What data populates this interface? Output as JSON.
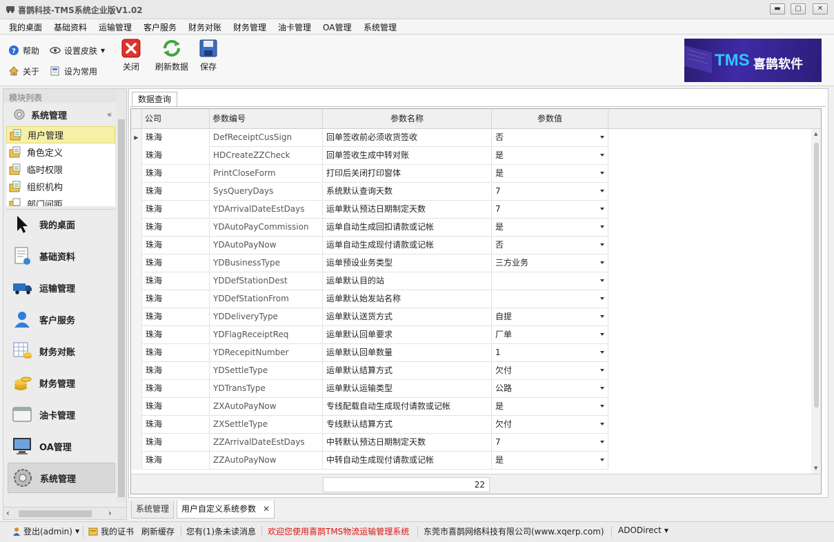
{
  "window": {
    "title": "喜鹊科技-TMS系统企业版V1.02",
    "min_label": "▬",
    "max_label": "□",
    "close_label": "✕"
  },
  "menu": {
    "items": [
      "我的桌面",
      "基础资料",
      "运输管理",
      "客户服务",
      "财务对账",
      "财务管理",
      "油卡管理",
      "OA管理",
      "系统管理"
    ]
  },
  "toolbar": {
    "help": "帮助",
    "skin": "设置皮肤",
    "about": "关于",
    "set_common": "设为常用",
    "close": "关闭",
    "refresh": "刷新数据",
    "save": "保存"
  },
  "logo": {
    "tms": "TMS",
    "brand": "喜鹊软件"
  },
  "left_panel": {
    "header": "模块列表",
    "group": "系统管理",
    "collapse": "«",
    "sub_items": [
      "用户管理",
      "角色定义",
      "临时权限",
      "组织机构",
      "部门间距"
    ],
    "selected_sub": 0,
    "nav": [
      "我的桌面",
      "基础资料",
      "运输管理",
      "客户服务",
      "财务对账",
      "财务管理",
      "油卡管理",
      "OA管理",
      "系统管理"
    ],
    "active_nav": 8,
    "scroll_left": "‹",
    "scroll_right": "›"
  },
  "main": {
    "tab": "数据查询",
    "columns": [
      "公司",
      "参数编号",
      "参数名称",
      "参数值"
    ],
    "rows": [
      {
        "company": "珠海",
        "code": "DefReceiptCusSign",
        "name": "回单签收前必须收货签收",
        "value": "否"
      },
      {
        "company": "珠海",
        "code": "HDCreateZZCheck",
        "name": "回单签收生成中转对账",
        "value": "是"
      },
      {
        "company": "珠海",
        "code": "PrintCloseForm",
        "name": "打印后关闭打印窗体",
        "value": "是"
      },
      {
        "company": "珠海",
        "code": "SysQueryDays",
        "name": "系统默认查询天数",
        "value": "7"
      },
      {
        "company": "珠海",
        "code": "YDArrivalDateEstDays",
        "name": "运单默认预达日期制定天数",
        "value": "7"
      },
      {
        "company": "珠海",
        "code": "YDAutoPayCommission",
        "name": "运单自动生成回扣请款或记帐",
        "value": "是"
      },
      {
        "company": "珠海",
        "code": "YDAutoPayNow",
        "name": "运单自动生成现付请款或记帐",
        "value": "否"
      },
      {
        "company": "珠海",
        "code": "YDBusinessType",
        "name": "运单预设业务类型",
        "value": "三方业务"
      },
      {
        "company": "珠海",
        "code": "YDDefStationDest",
        "name": "运单默认目的站",
        "value": ""
      },
      {
        "company": "珠海",
        "code": "YDDefStationFrom",
        "name": "运单默认始发站名称",
        "value": ""
      },
      {
        "company": "珠海",
        "code": "YDDeliveryType",
        "name": "运单默认送货方式",
        "value": "自提"
      },
      {
        "company": "珠海",
        "code": "YDFlagReceiptReq",
        "name": "运单默认回单要求",
        "value": "厂单"
      },
      {
        "company": "珠海",
        "code": "YDRecepitNumber",
        "name": "运单默认回单数量",
        "value": "1"
      },
      {
        "company": "珠海",
        "code": "YDSettleType",
        "name": "运单默认结算方式",
        "value": "欠付"
      },
      {
        "company": "珠海",
        "code": "YDTransType",
        "name": "运单默认运输类型",
        "value": "公路"
      },
      {
        "company": "珠海",
        "code": "ZXAutoPayNow",
        "name": "专线配载自动生成现付请款或记帐",
        "value": "是"
      },
      {
        "company": "珠海",
        "code": "ZXSettleType",
        "name": "专线默认结算方式",
        "value": "欠付"
      },
      {
        "company": "珠海",
        "code": "ZZArrivalDateEstDays",
        "name": "中转默认预达日期制定天数",
        "value": "7"
      },
      {
        "company": "珠海",
        "code": "ZZAutoPayNow",
        "name": "中转自动生成现付请款或记帐",
        "value": "是"
      }
    ],
    "row_indicator": "▶",
    "total_count": "22"
  },
  "doc_tabs": {
    "tab1": "系统管理",
    "tab2": "用户自定义系统参数",
    "close": "✕"
  },
  "status": {
    "logout": "登出(admin)",
    "cert": "我的证书",
    "refresh_cache": "刷新缓存",
    "unread": "您有(1)条未读消息",
    "welcome": "欢迎您使用喜鹊TMS物流运输管理系统",
    "company": "东莞市喜鹊网络科技有限公司(www.xqerp.com)",
    "mode": "ADODirect"
  },
  "colors": {
    "selected_sub_bg": "#f5f0a8",
    "welcome_text": "#dd1111",
    "logo_bg": "#3e2aa6",
    "logo_tms": "#2fc6ff"
  }
}
